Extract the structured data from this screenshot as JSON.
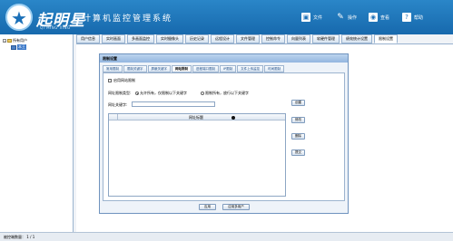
{
  "header": {
    "logo_name": "起明星",
    "logo_sub": "QI MING XING",
    "app_title": "计算机监控管理系统",
    "buttons": [
      {
        "label": "文件",
        "icon": "folder-icon"
      },
      {
        "label": "操作",
        "icon": "wrench-icon"
      },
      {
        "label": "查看",
        "icon": "search-icon"
      },
      {
        "label": "帮助",
        "icon": "help-icon"
      }
    ]
  },
  "tree": {
    "root_label": "所有用户",
    "child_label": "本王"
  },
  "tabs": [
    "用户信息",
    "实时画面",
    "多画面监控",
    "实时摄像头",
    "历史记录",
    "远程设计",
    "文件管理",
    "控制命令",
    "向量列表",
    "软硬件管理",
    "绩效统计设置",
    "限制设置"
  ],
  "active_tab": 11,
  "dialog": {
    "title": "限制设置",
    "inner_tabs": [
      "常用限制",
      "限制关键字",
      "屏蔽关键字",
      "网站限制",
      "进程端口限制",
      "IP限制",
      "文件上传监控",
      "时间限制"
    ],
    "active_inner_tab": 3,
    "enable_label": "启用网站限制",
    "type_label": "网址限制类型:",
    "radio_allow": "允许所有，仅限制以下关键字",
    "radio_block": "限制所有，放行以下关键字",
    "keyword_label": "网址关键字:",
    "grid_header": "网址标题",
    "side_buttons": [
      "创建",
      "修改",
      "删除",
      "提交"
    ],
    "footer_buttons": [
      "应用",
      "应用多用户"
    ]
  },
  "status": "被控端数量：  1 / 1"
}
